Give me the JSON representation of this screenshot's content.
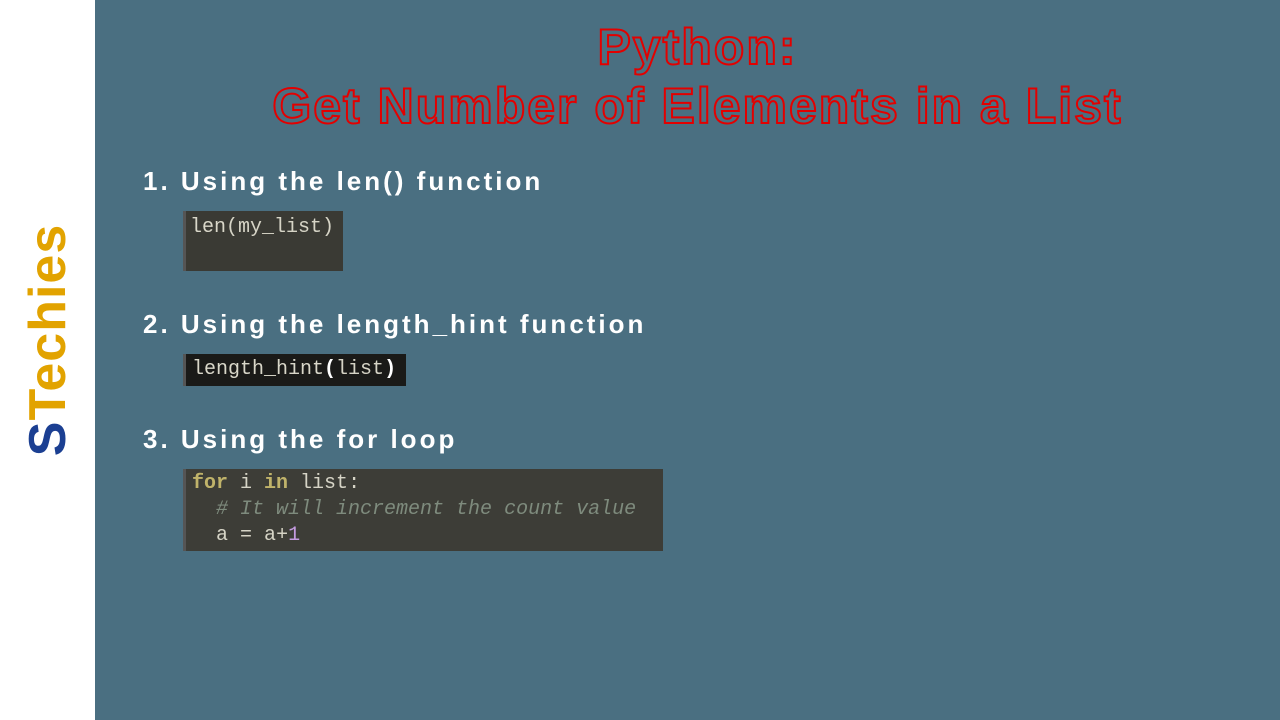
{
  "logo": {
    "part1": "S",
    "part2": "T",
    "part3": "echies"
  },
  "title": {
    "line1": "Python:",
    "line2": "Get Number of Elements in a List"
  },
  "sections": [
    {
      "heading": "1. Using the len() function",
      "code": {
        "fn": "len",
        "open": "(",
        "arg": "my_list",
        "close": ")"
      }
    },
    {
      "heading": "2. Using the length_hint function",
      "code": {
        "fn": "length_hint",
        "open": "(",
        "arg": "list",
        "close": ")"
      }
    },
    {
      "heading": "3. Using the for loop",
      "code": {
        "l1_kw1": "for",
        "l1_var": " i ",
        "l1_kw2": "in",
        "l1_list": " list",
        "l1_colon": ":",
        "l2_comment": "# It will increment the count value",
        "l3_lhs": "a ",
        "l3_eq": "=",
        "l3_rhs1": " a",
        "l3_plus": "+",
        "l3_num": "1"
      }
    }
  ]
}
